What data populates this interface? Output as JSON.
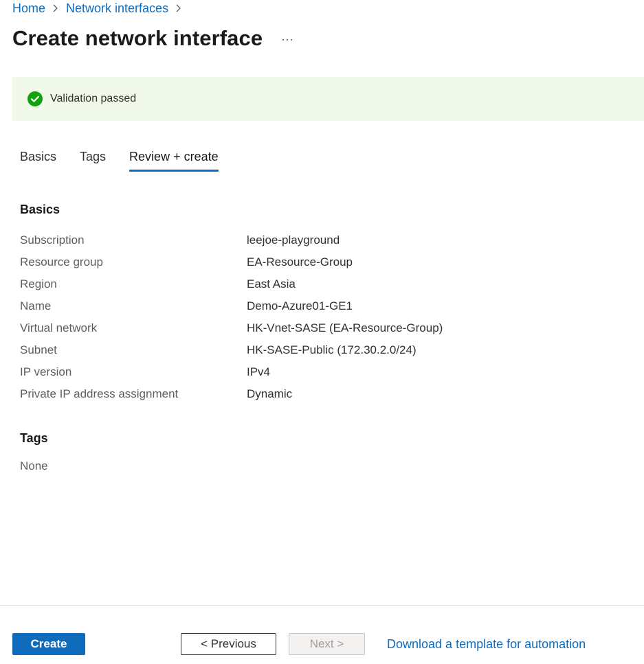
{
  "breadcrumb": {
    "items": [
      {
        "label": "Home"
      },
      {
        "label": "Network interfaces"
      }
    ]
  },
  "header": {
    "title": "Create network interface",
    "more_label": "···"
  },
  "validation": {
    "message": "Validation passed",
    "status_color": "#13a10e",
    "icon": "checkmark-circle-icon"
  },
  "tabs": [
    {
      "label": "Basics",
      "active": false
    },
    {
      "label": "Tags",
      "active": false
    },
    {
      "label": "Review + create",
      "active": true
    }
  ],
  "basics": {
    "heading": "Basics",
    "rows": [
      {
        "label": "Subscription",
        "value": "leejoe-playground"
      },
      {
        "label": "Resource group",
        "value": "EA-Resource-Group"
      },
      {
        "label": "Region",
        "value": "East Asia"
      },
      {
        "label": "Name",
        "value": "Demo-Azure01-GE1"
      },
      {
        "label": "Virtual network",
        "value": "HK-Vnet-SASE (EA-Resource-Group)"
      },
      {
        "label": "Subnet",
        "value": "HK-SASE-Public (172.30.2.0/24)"
      },
      {
        "label": "IP version",
        "value": "IPv4"
      },
      {
        "label": "Private IP address assignment",
        "value": "Dynamic"
      }
    ]
  },
  "tags": {
    "heading": "Tags",
    "value": "None"
  },
  "footer": {
    "create_label": "Create",
    "previous_label": "< Previous",
    "next_label": "Next >",
    "download_label": "Download a template for automation"
  },
  "colors": {
    "accent": "#0f6cbd",
    "banner_background": "#f1faea"
  }
}
